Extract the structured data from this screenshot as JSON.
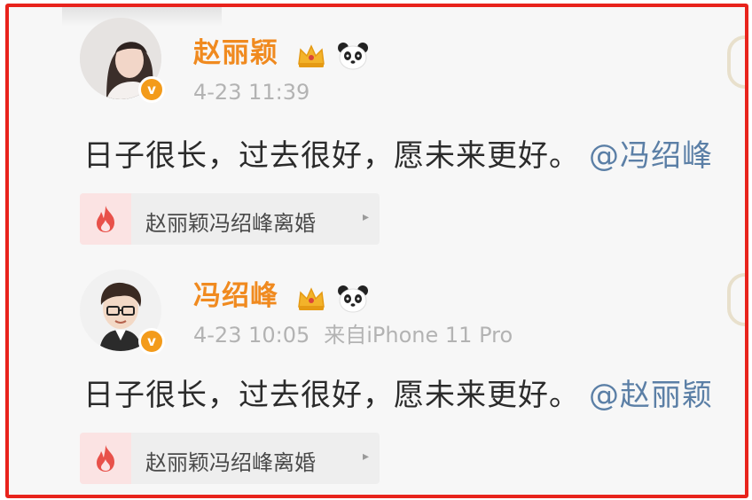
{
  "posts": [
    {
      "username": "赵丽颖",
      "date": "4-23 11:39",
      "device": "",
      "text": "日子很长，过去很好，愿未来更好。",
      "mention": "@冯绍峰",
      "topic": "赵丽颖冯绍峰离婚",
      "verified_mark": "v",
      "topic_arrow": "▸"
    },
    {
      "username": "冯绍峰",
      "date": "4-23 10:05",
      "device": "来自iPhone 11 Pro",
      "text": "日子很长，过去很好，愿未来更好。",
      "mention": "@赵丽颖",
      "topic": "赵丽颖冯绍峰离婚",
      "verified_mark": "v",
      "topic_arrow": "▸"
    }
  ],
  "colors": {
    "frame_border": "#e8231c",
    "username": "#f08a1f",
    "meta": "#b3b3b3",
    "mention": "#5b7fa6",
    "topic_icon": "#e8514a",
    "verified": "#f39b1b"
  }
}
